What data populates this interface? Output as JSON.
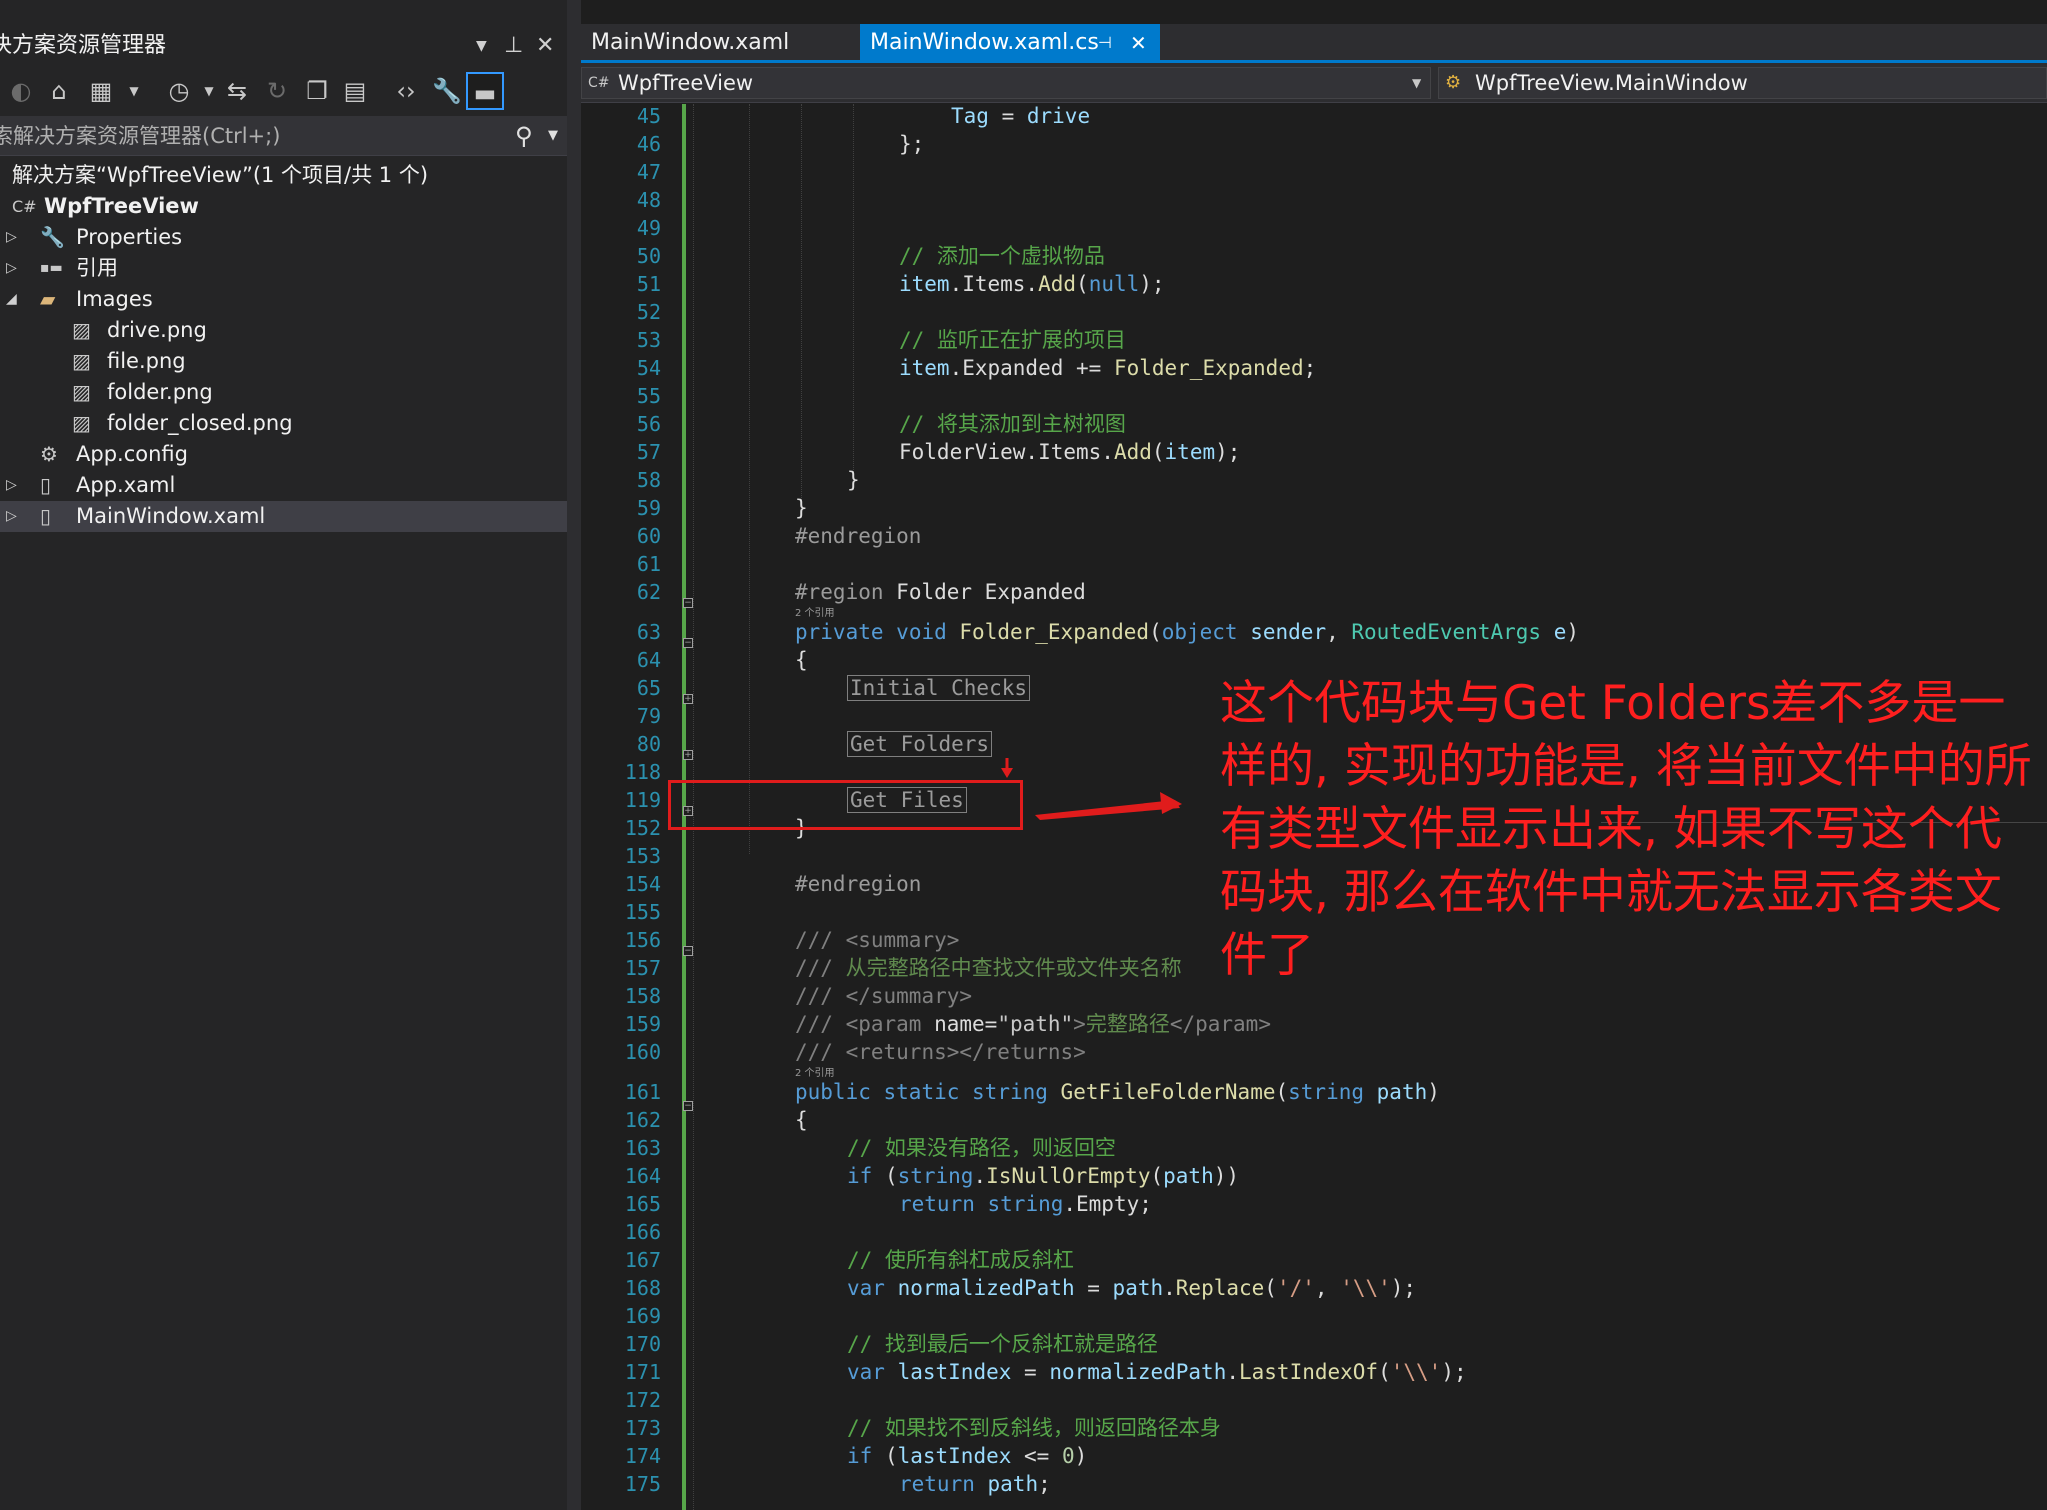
{
  "solution_explorer": {
    "title": "决方案资源管理器",
    "search_placeholder": "索解决方案资源管理器(Ctrl+;)",
    "tree": [
      {
        "label": "解决方案“WpfTreeView”(1 个项目/共 1 个)",
        "icon": "solution-icon"
      },
      {
        "label": "WpfTreeView",
        "icon": "csharp-project-icon"
      },
      {
        "label": "Properties",
        "icon": "wrench-icon"
      },
      {
        "label": "引用",
        "icon": "references-icon"
      },
      {
        "label": "Images",
        "icon": "folder-open-icon"
      },
      {
        "label": "drive.png",
        "icon": "image-file-icon"
      },
      {
        "label": "file.png",
        "icon": "image-file-icon"
      },
      {
        "label": "folder.png",
        "icon": "image-file-icon"
      },
      {
        "label": "folder_closed.png",
        "icon": "image-file-icon"
      },
      {
        "label": "App.config",
        "icon": "config-file-icon"
      },
      {
        "label": "App.xaml",
        "icon": "xaml-file-icon"
      },
      {
        "label": "MainWindow.xaml",
        "icon": "xaml-file-icon"
      }
    ]
  },
  "tabs": {
    "inactive": "MainWindow.xaml",
    "active": "MainWindow.xaml.cs"
  },
  "navbar": {
    "project": "WpfTreeView",
    "class": "WpfTreeView.MainWindow"
  },
  "editor": {
    "line_numbers": [
      "45",
      "46",
      "47",
      "48",
      "49",
      "50",
      "51",
      "52",
      "53",
      "54",
      "55",
      "56",
      "57",
      "58",
      "59",
      "60",
      "61",
      "62",
      "63",
      "64",
      "65",
      "79",
      "80",
      "118",
      "119",
      "152",
      "153",
      "154",
      "155",
      "156",
      "157",
      "158",
      "159",
      "160",
      "161",
      "162",
      "163",
      "164",
      "165",
      "166",
      "167",
      "168",
      "169",
      "170",
      "171",
      "172",
      "173",
      "174",
      "175"
    ],
    "ref_labels": [
      "2 个引用",
      "2 个引用"
    ],
    "comments": {
      "c50": "// 添加一个虚拟物品",
      "c53": "// 监听正在扩展的项目",
      "c56": "// 将其添加到主树视图",
      "c157": "从完整路径中查找文件或文件夹名称",
      "c159": "完整路径",
      "c163": "// 如果没有路径，则返回空",
      "c167": "// 使所有斜杠成反斜杠",
      "c170": "// 找到最后一个反斜杠就是路径",
      "c173": "// 如果找不到反斜线，则返回路径本身"
    },
    "regions": {
      "region_name": "Folder Expanded",
      "collapsed_1": "Initial Checks",
      "collapsed_2": "Get Folders",
      "collapsed_3": "Get Files"
    }
  },
  "annotation": {
    "text": "这个代码块与Get Folders差不多是一样的, 实现的功能是, 将当前文件中的所有类型文件显示出来, 如果不写这个代码块, 那么在软件中就无法显示各类文件了",
    "color": "#ff1f1f"
  }
}
